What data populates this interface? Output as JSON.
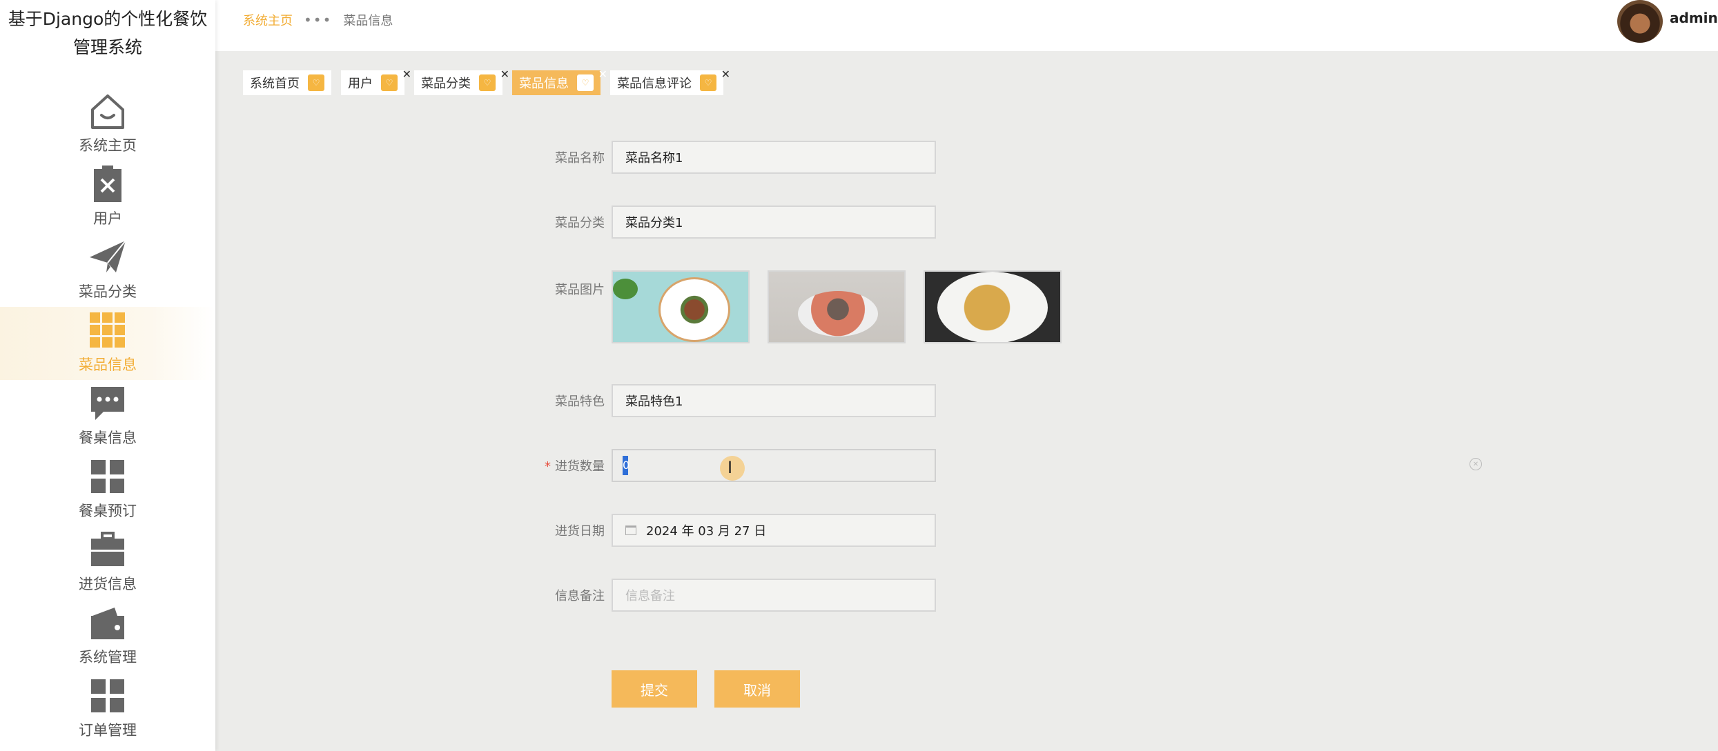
{
  "app": {
    "title": "基于Django的个性化餐饮管理系统"
  },
  "sidebar": {
    "items": [
      {
        "label": "系统主页",
        "icon": "home-icon"
      },
      {
        "label": "用户",
        "icon": "clipboard-x-icon"
      },
      {
        "label": "菜品分类",
        "icon": "paper-plane-icon"
      },
      {
        "label": "菜品信息",
        "icon": "grid-icon",
        "active": true
      },
      {
        "label": "餐桌信息",
        "icon": "chat-bubble-icon"
      },
      {
        "label": "餐桌预订",
        "icon": "apps-icon"
      },
      {
        "label": "进货信息",
        "icon": "briefcase-icon"
      },
      {
        "label": "系统管理",
        "icon": "wallet-icon"
      },
      {
        "label": "订单管理",
        "icon": "apps-icon"
      }
    ]
  },
  "topbar": {
    "breadcrumb": {
      "home": "系统主页",
      "separator": "•••",
      "current": "菜品信息"
    },
    "user": "admin"
  },
  "tabs": [
    {
      "label": "系统首页",
      "closable": false
    },
    {
      "label": "用户",
      "closable": true
    },
    {
      "label": "菜品分类",
      "closable": true
    },
    {
      "label": "菜品信息",
      "closable": true,
      "active": true
    },
    {
      "label": "菜品信息评论",
      "closable": true
    }
  ],
  "form": {
    "name": {
      "label": "菜品名称",
      "value": "菜品名称1"
    },
    "category": {
      "label": "菜品分类",
      "value": "菜品分类1"
    },
    "images": {
      "label": "菜品图片"
    },
    "feature": {
      "label": "菜品特色",
      "value": "菜品特色1"
    },
    "quantity": {
      "label": "进货数量",
      "value": "0",
      "required": "*"
    },
    "date": {
      "label": "进货日期",
      "value": "2024 年 03 月 27 日"
    },
    "remark": {
      "label": "信息备注",
      "placeholder": "信息备注"
    },
    "submit": "提交",
    "cancel": "取消"
  },
  "colors": {
    "accent": "#f5b95a",
    "accent_text": "#f2ad35"
  }
}
